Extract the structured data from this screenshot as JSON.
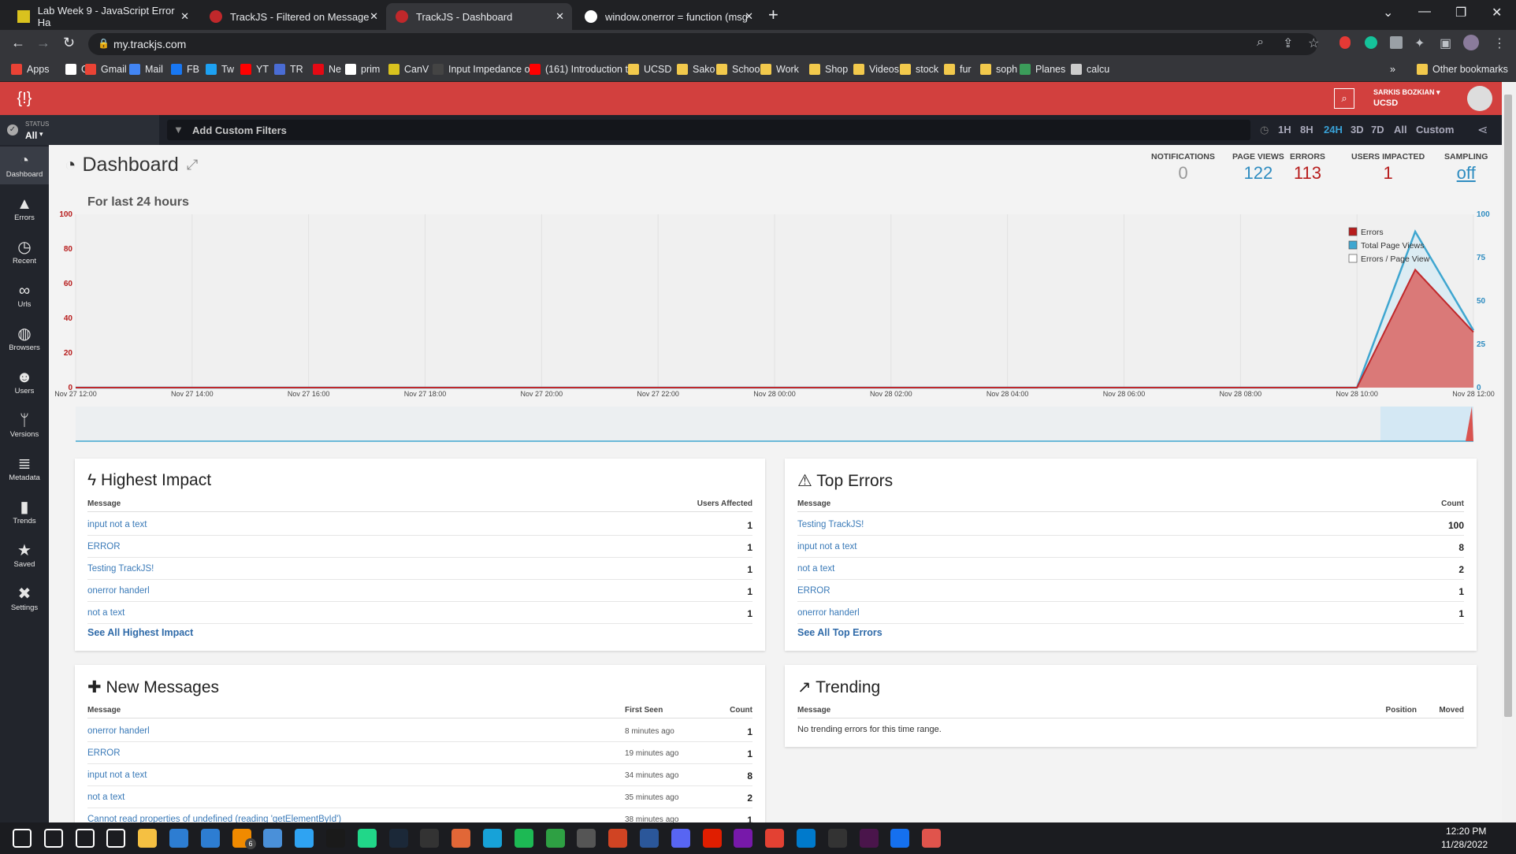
{
  "browser": {
    "tabs": [
      {
        "title": "Lab Week 9 - JavaScript Error Ha",
        "active": false
      },
      {
        "title": "TrackJS - Filtered on Message",
        "active": false
      },
      {
        "title": "TrackJS - Dashboard",
        "active": true
      },
      {
        "title": "window.onerror = function (msg",
        "active": false
      }
    ],
    "url": "my.trackjs.com",
    "bookmarks": [
      "Apps",
      "G",
      "Gmail",
      "Mail",
      "FB",
      "Tw",
      "YT",
      "TR",
      "Ne",
      "prim",
      "CanV",
      "Input Impedance of...",
      "(161) Introduction t...",
      "UCSD",
      "Sako",
      "School",
      "Work",
      "Shop",
      "Videos",
      "stock",
      "fur",
      "soph",
      "Planes",
      "calcu"
    ],
    "other_bookmarks": "Other bookmarks"
  },
  "header": {
    "user_name": "SARKIS BOZKIAN ▾",
    "org": "UCSD"
  },
  "filterbar": {
    "status_label": "STATUS",
    "status_value": "All",
    "placeholder": "Add Custom Filters",
    "ranges": [
      "1H",
      "8H",
      "24H",
      "3D",
      "7D",
      "All",
      "Custom"
    ],
    "selected_range": "24H"
  },
  "sidebar": {
    "items": [
      {
        "label": "Dashboard",
        "icon": "dashboard-icon"
      },
      {
        "label": "Errors",
        "icon": "warning-icon"
      },
      {
        "label": "Recent",
        "icon": "clock-icon"
      },
      {
        "label": "Urls",
        "icon": "link-icon"
      },
      {
        "label": "Browsers",
        "icon": "globe-icon"
      },
      {
        "label": "Users",
        "icon": "users-icon"
      },
      {
        "label": "Versions",
        "icon": "branch-icon"
      },
      {
        "label": "Metadata",
        "icon": "database-icon"
      },
      {
        "label": "Trends",
        "icon": "bar-chart-icon"
      },
      {
        "label": "Saved",
        "icon": "star-icon"
      },
      {
        "label": "Settings",
        "icon": "tools-icon"
      }
    ]
  },
  "dashboard": {
    "title": "Dashboard",
    "stats": [
      {
        "label": "NOTIFICATIONS",
        "value": "0",
        "color": "#999999"
      },
      {
        "label": "PAGE VIEWS",
        "value": "122",
        "color": "#2e8cc0"
      },
      {
        "label": "ERRORS",
        "value": "113",
        "color": "#b71c1c"
      },
      {
        "label": "USERS IMPACTED",
        "value": "1",
        "color": "#b71c1c"
      },
      {
        "label": "SAMPLING",
        "value": "off",
        "color": "#2e8cc0"
      }
    ],
    "chart_title": "For last 24 hours"
  },
  "chart_data": {
    "type": "area",
    "title": "For last 24 hours",
    "x_ticks": [
      "Nov 27 12:00",
      "Nov 27 14:00",
      "Nov 27 16:00",
      "Nov 27 18:00",
      "Nov 27 20:00",
      "Nov 27 22:00",
      "Nov 28 00:00",
      "Nov 28 02:00",
      "Nov 28 04:00",
      "Nov 28 06:00",
      "Nov 28 08:00",
      "Nov 28 10:00",
      "Nov 28 12:00"
    ],
    "y_left_ticks": [
      0,
      20,
      40,
      60,
      80,
      100
    ],
    "y_right_ticks": [
      0,
      25,
      50,
      75,
      100
    ],
    "ylim_left": [
      0,
      100
    ],
    "ylim_right": [
      0,
      100
    ],
    "legend": [
      "Errors",
      "Total Page Views",
      "Errors / Page View"
    ],
    "legend_position": "top-right",
    "x_hours": [
      0,
      22,
      23,
      24
    ],
    "series": [
      {
        "name": "Errors",
        "axis": "left",
        "color": "#c0282b",
        "values": [
          0,
          0,
          68,
          32
        ]
      },
      {
        "name": "Total Page Views",
        "axis": "right",
        "color": "#3fa6d0",
        "values": [
          0,
          0,
          90,
          33
        ]
      },
      {
        "name": "Errors / Page View",
        "axis": "right",
        "color": "#ffffff",
        "values": [
          0,
          0,
          0,
          0
        ]
      }
    ]
  },
  "highest_impact": {
    "title": "Highest Impact",
    "col_message": "Message",
    "col_value": "Users Affected",
    "rows": [
      {
        "message": "input not a text",
        "value": "1"
      },
      {
        "message": "ERROR",
        "value": "1"
      },
      {
        "message": "Testing TrackJS!",
        "value": "1"
      },
      {
        "message": "onerror handerl",
        "value": "1"
      },
      {
        "message": "not a text",
        "value": "1"
      }
    ],
    "see_all": "See All Highest Impact"
  },
  "top_errors": {
    "title": "Top Errors",
    "col_message": "Message",
    "col_value": "Count",
    "rows": [
      {
        "message": "Testing TrackJS!",
        "value": "100"
      },
      {
        "message": "input not a text",
        "value": "8"
      },
      {
        "message": "not a text",
        "value": "2"
      },
      {
        "message": "ERROR",
        "value": "1"
      },
      {
        "message": "onerror handerl",
        "value": "1"
      }
    ],
    "see_all": "See All Top Errors"
  },
  "new_messages": {
    "title": "New Messages",
    "col_message": "Message",
    "col_first_seen": "First Seen",
    "col_count": "Count",
    "rows": [
      {
        "message": "onerror handerl",
        "first_seen": "8 minutes ago",
        "count": "1"
      },
      {
        "message": "ERROR",
        "first_seen": "19 minutes ago",
        "count": "1"
      },
      {
        "message": "input not a text",
        "first_seen": "34 minutes ago",
        "count": "8"
      },
      {
        "message": "not a text",
        "first_seen": "35 minutes ago",
        "count": "2"
      },
      {
        "message": "Cannot read properties of undefined (reading 'getElementById')",
        "first_seen": "38 minutes ago",
        "count": "1"
      }
    ]
  },
  "trending": {
    "title": "Trending",
    "col_message": "Message",
    "col_position": "Position",
    "col_moved": "Moved",
    "empty": "No trending errors for this time range."
  },
  "taskbar": {
    "time": "12:20 PM",
    "date": "11/28/2022",
    "mail_badge": "6"
  }
}
